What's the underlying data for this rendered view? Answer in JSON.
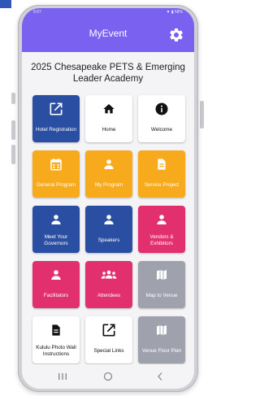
{
  "colors": {
    "app_bar": "#7b61f0",
    "tile_blue": "#2a4ea1",
    "tile_orange": "#f7aa1c",
    "tile_pink": "#e22f6e",
    "tile_gray": "#9fa2ad",
    "tile_white": "#ffffff"
  },
  "status_bar": {
    "time": "5:07",
    "icons": "▼ ▮ 58%"
  },
  "app_bar": {
    "title": "MyEvent",
    "settings_icon": "gear-icon"
  },
  "event_title": "2025 Chesapeake PETS & Emerging Leader Academy",
  "tiles": [
    {
      "label": "Hotel Registration",
      "icon": "external-link-icon",
      "color": "blue"
    },
    {
      "label": "Home",
      "icon": "home-icon",
      "color": "white"
    },
    {
      "label": "Welcome",
      "icon": "info-icon",
      "color": "white"
    },
    {
      "label": "General Program",
      "icon": "calendar-icon",
      "color": "orange"
    },
    {
      "label": "My Program",
      "icon": "person-icon",
      "color": "orange"
    },
    {
      "label": "Service Project",
      "icon": "document-icon",
      "color": "orange"
    },
    {
      "label": "Meet Your Governors",
      "icon": "person-icon",
      "color": "blue"
    },
    {
      "label": "Speakers",
      "icon": "person-icon",
      "color": "blue"
    },
    {
      "label": "Vendors & Exhibitors",
      "icon": "person-icon",
      "color": "pink"
    },
    {
      "label": "Facilitators",
      "icon": "person-icon",
      "color": "pink"
    },
    {
      "label": "Attendees",
      "icon": "group-icon",
      "color": "pink"
    },
    {
      "label": "Map to Venue",
      "icon": "map-icon",
      "color": "gray"
    },
    {
      "label": "Kululu Photo Wall Instructions",
      "icon": "document-icon",
      "color": "white"
    },
    {
      "label": "Special Links",
      "icon": "external-link-icon",
      "color": "white"
    },
    {
      "label": "Venue Floor Plan",
      "icon": "map-icon",
      "color": "gray"
    }
  ],
  "nav_bar": {
    "recents": "recents-icon",
    "home": "home-circle-icon",
    "back": "back-icon"
  }
}
